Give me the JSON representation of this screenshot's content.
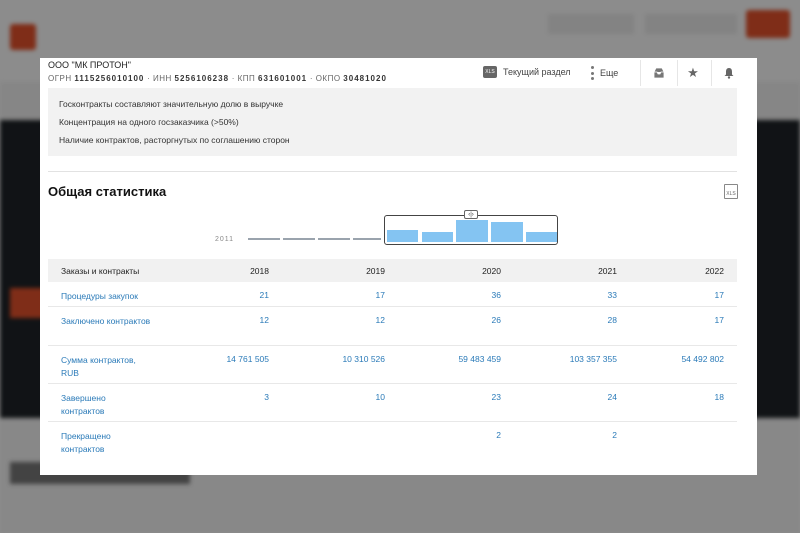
{
  "header": {
    "company": "ООО \"МК ПРОТОН\"",
    "ogrn_label": "ОГРН",
    "ogrn": "1115256010100",
    "inn_label": "ИНН",
    "inn": "5256106238",
    "kpp_label": "КПП",
    "kpp": "631601001",
    "okpo_label": "ОКПО",
    "okpo": "30481020",
    "current_section_label": "Текущий раздел",
    "more_label": "Еще",
    "xls_icon_text": "XLS"
  },
  "risks": [
    "Госконтракты составляют значительную долю в выручке",
    "Концентрация на одного госзаказчика (>50%)",
    "Наличие контрактов, расторгнутых по соглашению сторон"
  ],
  "stats": {
    "title": "Общая статистика",
    "timeline_start_year": "2011",
    "timeline_handle": "‹|›",
    "timeline_bars": [
      0.55,
      0.45,
      1.0,
      0.9,
      0.45
    ]
  },
  "table": {
    "header_label": "Заказы и контракты",
    "years": [
      "2018",
      "2019",
      "2020",
      "2021",
      "2022"
    ],
    "rows": [
      {
        "label": "Процедуры закупок",
        "values": [
          "21",
          "17",
          "36",
          "33",
          "17"
        ]
      },
      {
        "label": "Заключено контрактов",
        "values": [
          "12",
          "12",
          "26",
          "28",
          "17"
        ]
      },
      {
        "label": "Сумма контрактов, RUB",
        "values": [
          "14 761 505",
          "10 310 526",
          "59 483 459",
          "103 357 355",
          "54 492 802"
        ]
      },
      {
        "label": "Завершено контрактов",
        "values": [
          "3",
          "10",
          "23",
          "24",
          "18"
        ]
      },
      {
        "label": "Прекращено контрактов",
        "values": [
          "",
          "",
          "2",
          "2",
          ""
        ]
      }
    ]
  },
  "colors": {
    "accent": "#e8532c",
    "link": "#2a7ab8",
    "bar": "#84c4f2"
  }
}
